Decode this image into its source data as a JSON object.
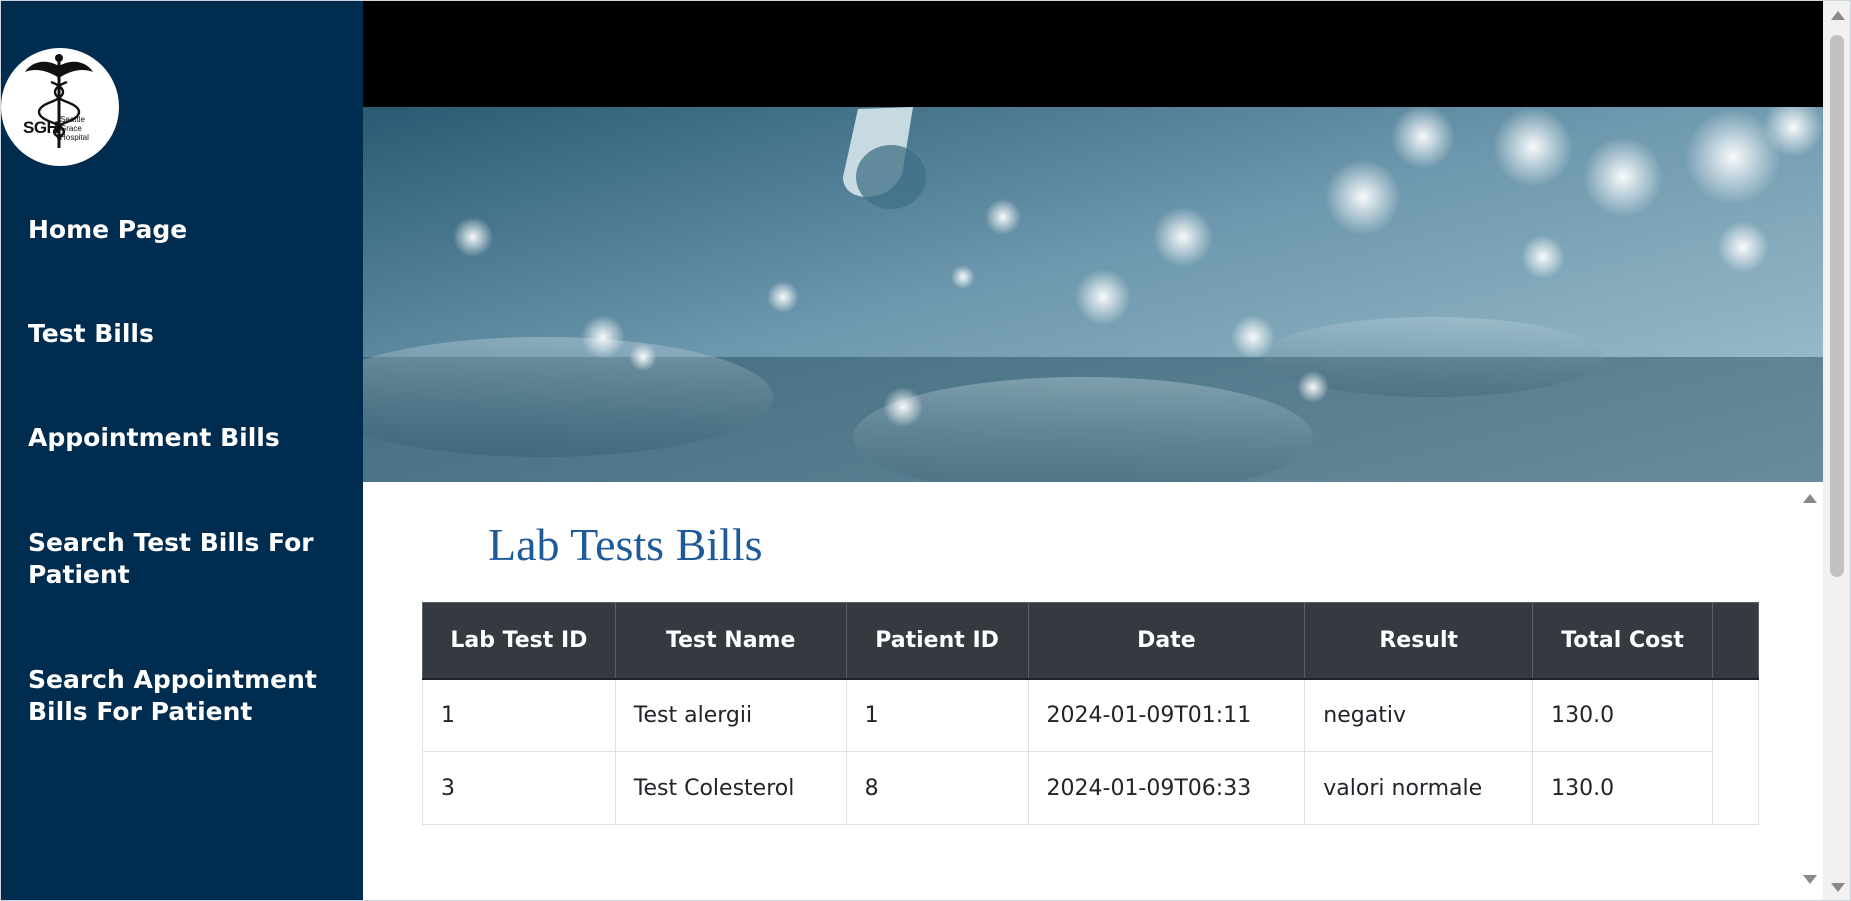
{
  "sidebar": {
    "logo": {
      "initials": "SGH",
      "line1": "Seattle",
      "line2": "Grace",
      "line3": "Hospital",
      "icon": "caduceus-icon"
    },
    "items": [
      {
        "label": "Home Page"
      },
      {
        "label": "Test Bills"
      },
      {
        "label": "Appointment Bills"
      },
      {
        "label": "Search Test Bills For Patient"
      },
      {
        "label": "Search Appointment Bills For Patient"
      }
    ]
  },
  "main": {
    "title": "Lab Tests Bills",
    "table": {
      "headers": [
        "Lab Test ID",
        "Test Name",
        "Patient ID",
        "Date",
        "Result",
        "Total Cost"
      ],
      "rows": [
        [
          "1",
          "Test alergii",
          "1",
          "2024-01-09T01:11",
          "negativ",
          "130.0"
        ],
        [
          "3",
          "Test Colesterol",
          "8",
          "2024-01-09T06:33",
          "valori normale",
          "130.0"
        ]
      ]
    }
  },
  "colors": {
    "sidebar_bg": "#002d4f",
    "title": "#1f5a99",
    "table_header_bg": "#343a40",
    "topbar": "#000000"
  }
}
